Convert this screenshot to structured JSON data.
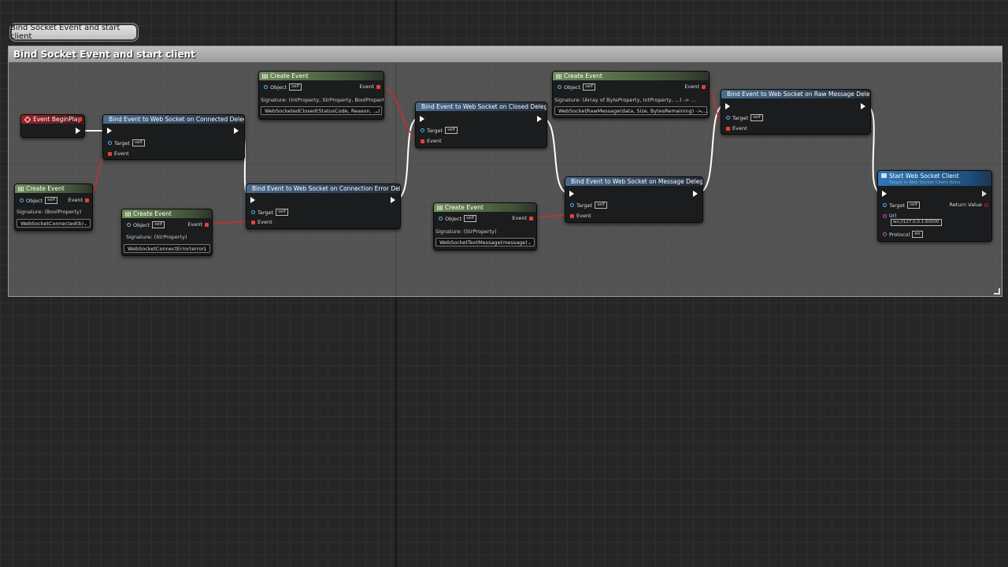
{
  "comment_bubble": "Bind Socket Event and start client",
  "comment_title": "Bind Socket Event and start client",
  "begin_play": {
    "title": "Event BeginPlay"
  },
  "bind_connected": {
    "title": "Bind Event to Web Socket on Connected Delegate",
    "target_label": "Target",
    "target_value": "self",
    "event_label": "Event"
  },
  "bind_error": {
    "title": "Bind Event to Web Socket on Connection Error Delegate",
    "target_label": "Target",
    "target_value": "self",
    "event_label": "Event"
  },
  "bind_closed": {
    "title": "Bind Event to Web Socket on Closed Delegate",
    "target_label": "Target",
    "target_value": "self",
    "event_label": "Event"
  },
  "bind_message": {
    "title": "Bind Event to Web Socket on Message Delegate",
    "target_label": "Target",
    "target_value": "self",
    "event_label": "Event"
  },
  "bind_raw": {
    "title": "Bind Event to Web Socket on Raw Message Delegate",
    "target_label": "Target",
    "target_value": "self",
    "event_label": "Event"
  },
  "create_connected": {
    "title": "Create Event",
    "object_label": "Object",
    "object_value": "self",
    "event_label": "Event",
    "signature": "Signature: (BoolProperty)",
    "function": "WebSocketConnected(b)"
  },
  "create_error": {
    "title": "Create Event",
    "object_label": "Object",
    "object_value": "self",
    "event_label": "Event",
    "signature": "Signature: (StrProperty)",
    "function": "WebSocketConnectError(error)"
  },
  "create_closed": {
    "title": "Create Event",
    "object_label": "Object",
    "object_value": "self",
    "event_label": "Event",
    "signature": "Signature: (IntProperty, StrProperty, BoolProperty)",
    "function": "WebSocketedClosed(StatusCode, Reason, ...)"
  },
  "create_message": {
    "title": "Create Event",
    "object_label": "Object",
    "object_value": "self",
    "event_label": "Event",
    "signature": "Signature: (StrProperty)",
    "function": "WebSocketTextMessage(message)"
  },
  "create_raw": {
    "title": "Create Event",
    "object_label": "Object",
    "object_value": "self",
    "event_label": "Event",
    "signature": "Signature: (Array of ByteProperty, IntProperty, ...) -> ...",
    "function": "WebSocketRawMessage(data, Size, BytesRemaining) -> ..."
  },
  "start_client": {
    "title": "Start Web Socket Client",
    "subtitle": "Target is Web Socket Client Actor",
    "target_label": "Target",
    "target_value": "self",
    "return_label": "Return Value",
    "url_label": "Url",
    "url_value": "ws://127.0.0.1:60000",
    "protocol_label": "Protocol",
    "protocol_value": "ws"
  },
  "colors": {
    "exec": "#ffffff",
    "delegate": "#e8403c",
    "object": "#57b4f0",
    "string": "#d14dce",
    "comment": "#9b9b9b"
  },
  "icons": {
    "function": "function-icon",
    "create_event": "create-event-icon",
    "event": "event-icon"
  }
}
